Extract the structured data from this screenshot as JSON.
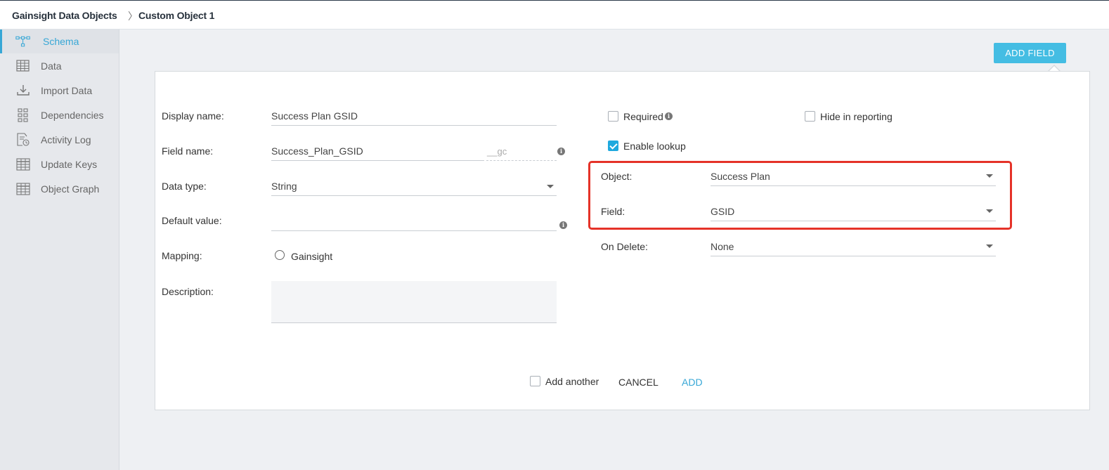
{
  "header": {
    "app_title": "Gainsight Data Objects",
    "breadcrumb_sep": "〉",
    "crumb": "Custom Object 1"
  },
  "sidebar": {
    "items": [
      {
        "label": "Schema",
        "icon": "schema-icon",
        "active": true
      },
      {
        "label": "Data",
        "icon": "table-icon"
      },
      {
        "label": "Import Data",
        "icon": "download-icon"
      },
      {
        "label": "Dependencies",
        "icon": "dependencies-icon"
      },
      {
        "label": "Activity Log",
        "icon": "activity-log-icon"
      },
      {
        "label": "Update Keys",
        "icon": "update-keys-icon"
      },
      {
        "label": "Object Graph",
        "icon": "object-graph-icon"
      }
    ]
  },
  "toolbar": {
    "add_field_label": "ADD FIELD"
  },
  "form": {
    "display_name_label": "Display name:",
    "display_name_value": "Success Plan GSID",
    "field_name_label": "Field name:",
    "field_name_value": "Success_Plan_GSID",
    "field_name_suffix": "__gc",
    "data_type_label": "Data type:",
    "data_type_value": "String",
    "default_value_label": "Default value:",
    "default_value_value": "",
    "mapping_label": "Mapping:",
    "mapping_option": "Gainsight",
    "description_label": "Description:",
    "required_label": "Required",
    "hide_in_reporting_label": "Hide in reporting",
    "enable_lookup_label": "Enable lookup",
    "object_label": "Object:",
    "object_value": "Success Plan",
    "field_label": "Field:",
    "field_value": "GSID",
    "on_delete_label": "On Delete:",
    "on_delete_value": "None",
    "info_glyph": "i"
  },
  "footer": {
    "add_another_label": "Add another",
    "cancel_label": "CANCEL",
    "add_label": "ADD"
  },
  "colors": {
    "accent": "#37a7d6",
    "button": "#44bde3",
    "highlight": "#e53228"
  }
}
